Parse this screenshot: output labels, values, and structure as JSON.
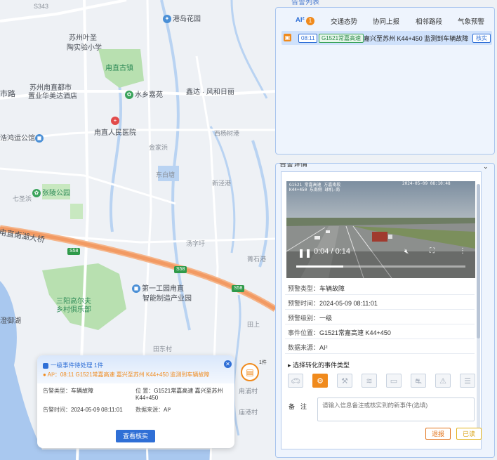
{
  "map": {
    "labels": [
      {
        "id": "S343",
        "text": "S343"
      },
      {
        "id": "gangdao",
        "text": "港岛花园"
      },
      {
        "id": "yeshen",
        "text": "苏州叶圣"
      },
      {
        "id": "taoshi",
        "text": "陶实验小学"
      },
      {
        "id": "guyuan",
        "text": "甪直古镇"
      },
      {
        "id": "dushi",
        "text": "苏州甪直都市"
      },
      {
        "id": "jiudian",
        "text": "置业华美达酒店"
      },
      {
        "id": "shuixiang",
        "text": "水乡嘉苑"
      },
      {
        "id": "xinda",
        "text": "鑫达 · 风和日丽"
      },
      {
        "id": "shilu",
        "text": "市路"
      },
      {
        "id": "hospital",
        "text": "甪直人民医院"
      },
      {
        "id": "gongguan",
        "text": "浩鸿运公馆"
      },
      {
        "id": "xiyang",
        "text": "西杨树港"
      },
      {
        "id": "jinjia",
        "text": "金家浜"
      },
      {
        "id": "dongbai",
        "text": "东白塘"
      },
      {
        "id": "xinjing",
        "text": "新泾港"
      },
      {
        "id": "zhangling",
        "text": "张陵公园"
      },
      {
        "id": "qiban",
        "text": "七圣浜"
      },
      {
        "id": "nanhu",
        "text": "甪直南湖大桥"
      },
      {
        "id": "tangshu",
        "text": "汤字圩"
      },
      {
        "id": "shixiang",
        "text": "菁石港"
      },
      {
        "id": "yigongqu",
        "text": "第一工园甪直"
      },
      {
        "id": "zhineng",
        "text": "智能制造产业园"
      },
      {
        "id": "gaoerfu",
        "text": "三阳高尔夫"
      },
      {
        "id": "julebu",
        "text": "乡村俱乐部"
      },
      {
        "id": "yuhu",
        "text": "澄御湖"
      },
      {
        "id": "tiandong",
        "text": "田东村"
      },
      {
        "id": "tianshang",
        "text": "田上"
      },
      {
        "id": "yuzhuang",
        "text": "甪浦村"
      },
      {
        "id": "xiangang",
        "text": "庙港村"
      }
    ],
    "road_tags": [
      "S58",
      "S58",
      "S58"
    ]
  },
  "event_panel": {
    "title": "告警列表",
    "tabs": [
      {
        "label": "AI²",
        "active": true,
        "badge": "1"
      },
      {
        "label": "交通态势",
        "active": false
      },
      {
        "label": "协同上报",
        "active": false
      },
      {
        "label": "相邻路段",
        "active": false
      },
      {
        "label": "气象预警",
        "active": false
      }
    ],
    "alerts": [
      {
        "icon": "car-icon",
        "time": "08:11",
        "road": "G1521常嘉高速",
        "text": "嘉兴至苏州 K44+450 监测到车辆故障",
        "action": "核实"
      }
    ]
  },
  "detail": {
    "title": "告警详情",
    "video": {
      "osd_line1": "G1521 常嘉高速 方嘉南段",
      "osd_line2": "K44+450 东南侧 球机-南",
      "osd_time": "2024-05-09 08:10:48",
      "current": "0:04",
      "duration": "0:14",
      "progress": 0.28
    },
    "fields": [
      {
        "k": "预警类型：",
        "v": "车辆故障"
      },
      {
        "k": "预警时间：",
        "v": "2024-05-09 08:11:01"
      },
      {
        "k": "预警级别：",
        "v": "一级"
      },
      {
        "k": "事件位置：",
        "v": "G1521常嘉高速 K44+450"
      },
      {
        "k": "数据来源：",
        "v": "AI²"
      }
    ],
    "section": "选择转化的事件类型",
    "event_types": [
      {
        "icon": "vehicle-icon",
        "active": false
      },
      {
        "icon": "breakdown-icon",
        "active": true
      },
      {
        "icon": "construction-icon",
        "active": false
      },
      {
        "icon": "traffic-jam-icon",
        "active": false
      },
      {
        "icon": "barrier-icon",
        "active": false
      },
      {
        "icon": "accident-icon",
        "active": false
      },
      {
        "icon": "warning-icon",
        "active": false
      },
      {
        "icon": "layers-icon",
        "active": false
      }
    ],
    "remark_label": "备注",
    "remark_placeholder": "请输入信息备注或核实到的新事件(选填)",
    "btn_back": "退报",
    "btn_read": "已读"
  },
  "popup": {
    "title": "一级事件待处理 1件",
    "event": "AI²：08:11 G1521常嘉高速 嘉兴至苏州 K44+450 监测到车辆故障",
    "fields": {
      "type_k": "告警类型：",
      "type_v": "车辆故障",
      "loc_k": "位    置：",
      "loc_v": "G1521常嘉高速 嘉兴至苏州 K44+450",
      "time_k": "告警时间：",
      "time_v": "2024-05-09 08:11:01",
      "src_k": "数据来源：",
      "src_v": "AI²"
    },
    "button": "查看核实"
  },
  "float_button": {
    "count": "1件"
  }
}
